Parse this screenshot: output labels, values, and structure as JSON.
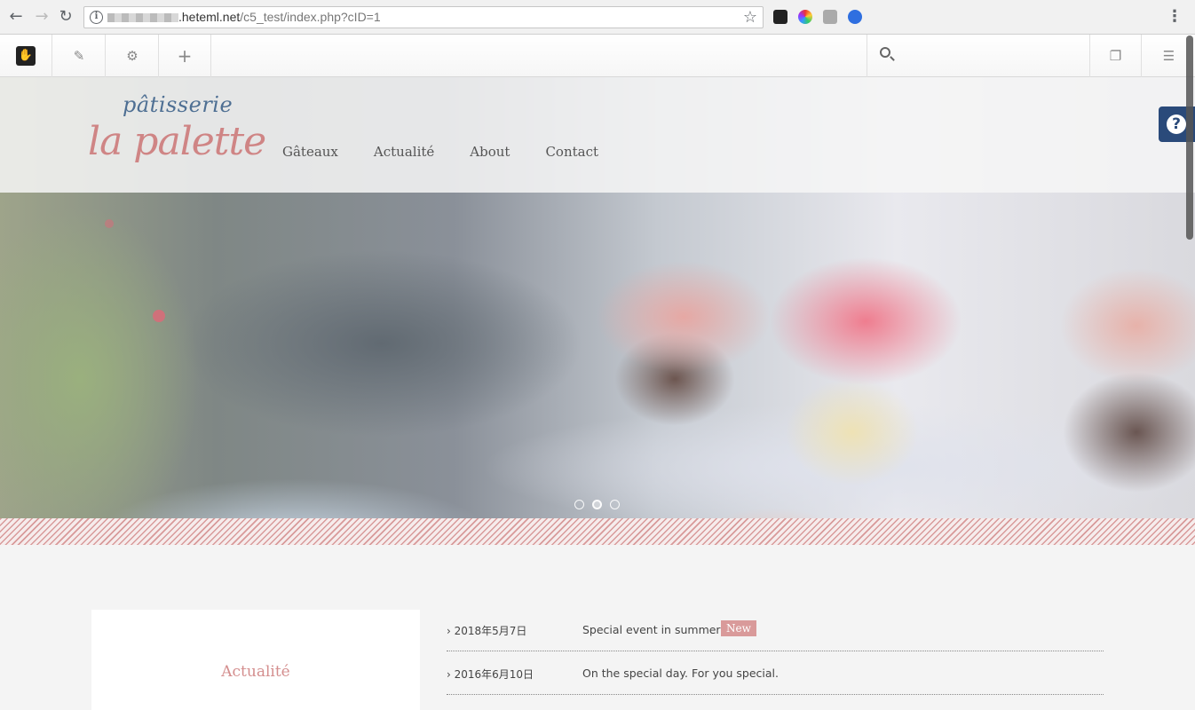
{
  "browser": {
    "url_host": ".heteml.net",
    "url_path": "/c5_test/index.php?cID=1",
    "back_icon": "←",
    "forward_icon": "→",
    "reload_icon": "↻",
    "star_icon": "☆",
    "menu_icon": "⋮"
  },
  "cms_toolbar": {
    "logo_icon": "✋",
    "edit_icon": "✎",
    "settings_icon": "⚙",
    "add_icon": "+",
    "pages_icon": "❐",
    "intelligent_icon": "☰",
    "search_value": ""
  },
  "site": {
    "logo_top": "pâtisserie",
    "logo_main": "la palette",
    "nav": [
      "Gâteaux",
      "Actualité",
      "About",
      "Contact"
    ],
    "help_icon": "?"
  },
  "slider": {
    "dots": 3,
    "active_index": 1
  },
  "news": {
    "card_title": "Actualité",
    "items": [
      {
        "date": "› 2018年5月7日",
        "title": "Special event in summer",
        "badge": "New"
      },
      {
        "date": "› 2016年6月10日",
        "title": "On the special day. For you special.",
        "badge": ""
      }
    ]
  },
  "colors": {
    "accent_pink": "#d48e8e",
    "logo_blue": "#4e6f93",
    "help_blue": "#2a4a7a"
  }
}
